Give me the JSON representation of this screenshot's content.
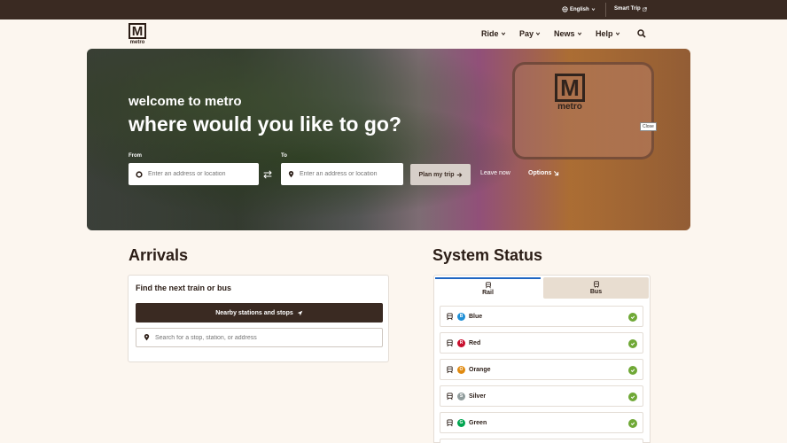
{
  "utility": {
    "language": "English",
    "smart_trip": "Smart Trip"
  },
  "logo": {
    "mark": "M",
    "text": "metro"
  },
  "nav": [
    {
      "label": "Ride"
    },
    {
      "label": "Pay"
    },
    {
      "label": "News"
    },
    {
      "label": "Help"
    }
  ],
  "hero": {
    "bus_logo_mark": "M",
    "bus_logo_text": "metro",
    "close_label": "Close",
    "subtitle": "welcome to metro",
    "title": "where would you like to go?",
    "from_label": "From",
    "to_label": "To",
    "from_placeholder": "Enter an address or location",
    "to_placeholder": "Enter an address or location",
    "plan_label": "Plan my trip",
    "leave_now": "Leave now",
    "options": "Options"
  },
  "arrivals": {
    "heading": "Arrivals",
    "card_title": "Find the next train or bus",
    "nearby_label": "Nearby stations and stops",
    "search_placeholder": "Search for a stop, station, or address"
  },
  "status": {
    "heading": "System Status",
    "tabs": [
      {
        "label": "Rail"
      },
      {
        "label": "Bus"
      }
    ],
    "lines": [
      {
        "name": "Blue",
        "code": "B",
        "color": "#1f8fd6"
      },
      {
        "name": "Red",
        "code": "R",
        "color": "#c8102e"
      },
      {
        "name": "Orange",
        "code": "O",
        "color": "#e08a10"
      },
      {
        "name": "Silver",
        "code": "S",
        "color": "#919d9d"
      },
      {
        "name": "Green",
        "code": "G",
        "color": "#00a550"
      }
    ]
  },
  "colors": {
    "brand_dark": "#3a2a22",
    "status_ok": "#6fa836",
    "tab_accent": "#1f66c2"
  }
}
